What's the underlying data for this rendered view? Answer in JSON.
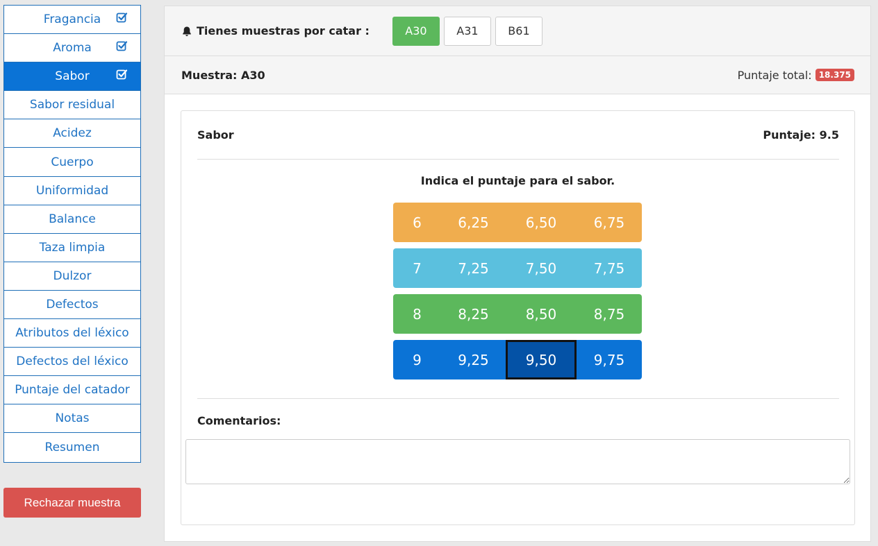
{
  "sidebar": {
    "items": [
      {
        "label": "Fragancia",
        "checked": true,
        "active": false
      },
      {
        "label": "Aroma",
        "checked": true,
        "active": false
      },
      {
        "label": "Sabor",
        "checked": true,
        "active": true
      },
      {
        "label": "Sabor residual",
        "checked": false,
        "active": false
      },
      {
        "label": "Acidez",
        "checked": false,
        "active": false
      },
      {
        "label": "Cuerpo",
        "checked": false,
        "active": false
      },
      {
        "label": "Uniformidad",
        "checked": false,
        "active": false
      },
      {
        "label": "Balance",
        "checked": false,
        "active": false
      },
      {
        "label": "Taza limpia",
        "checked": false,
        "active": false
      },
      {
        "label": "Dulzor",
        "checked": false,
        "active": false
      },
      {
        "label": "Defectos",
        "checked": false,
        "active": false
      },
      {
        "label": "Atributos del léxico",
        "checked": false,
        "active": false
      },
      {
        "label": "Defectos del léxico",
        "checked": false,
        "active": false
      },
      {
        "label": "Puntaje del catador",
        "checked": false,
        "active": false
      },
      {
        "label": "Notas",
        "checked": false,
        "active": false
      },
      {
        "label": "Resumen",
        "checked": false,
        "active": false
      }
    ],
    "reject_label": "Rechazar muestra",
    "reject_color": "#d9534f",
    "active_color": "#0b73d6",
    "check_icon": "checkbox-checked-icon"
  },
  "topbar": {
    "bell_icon": "bell-icon",
    "label": "Tienes muestras por catar :",
    "samples": [
      {
        "label": "A30",
        "active": true
      },
      {
        "label": "A31",
        "active": false
      },
      {
        "label": "B61",
        "active": false
      }
    ],
    "active_color": "#5cb85c"
  },
  "infobar": {
    "sample_label": "Muestra: A30",
    "total_label": "Puntaje total:",
    "total_value": "18.375",
    "badge_color": "#d9534f"
  },
  "card": {
    "title": "Sabor",
    "score_label": "Puntaje: 9.5",
    "instruction": "Indica el puntaje para el sabor.",
    "rows": [
      {
        "color": "#f0ad4e",
        "values": [
          "6",
          "6,25",
          "6,50",
          "6,75"
        ]
      },
      {
        "color": "#5bc0de",
        "values": [
          "7",
          "7,25",
          "7,50",
          "7,75"
        ]
      },
      {
        "color": "#5cb85c",
        "values": [
          "8",
          "8,25",
          "8,50",
          "8,75"
        ]
      },
      {
        "color": "#0b73d6",
        "values": [
          "9",
          "9,25",
          "9,50",
          "9,75"
        ]
      }
    ],
    "selected": "9,50",
    "comments_label": "Comentarios:",
    "comments_value": ""
  }
}
